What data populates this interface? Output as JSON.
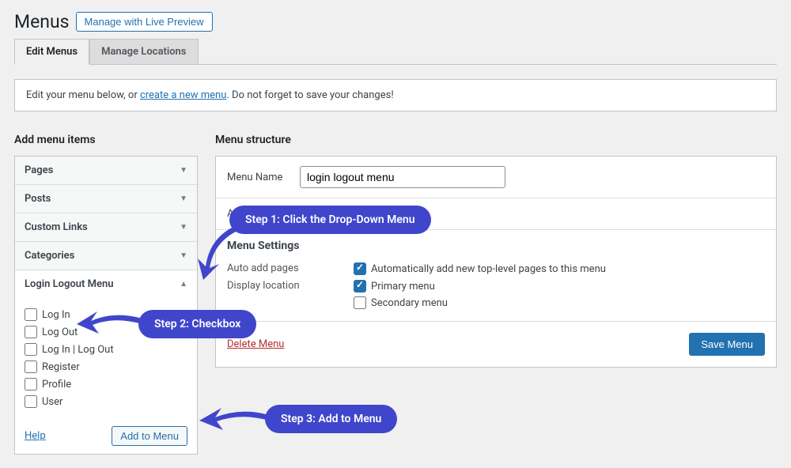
{
  "page_title": "Menus",
  "preview_button": "Manage with Live Preview",
  "tabs": {
    "edit": "Edit Menus",
    "locations": "Manage Locations"
  },
  "notice": {
    "prefix": "Edit your menu below, or ",
    "link": "create a new menu",
    "suffix": ". Do not forget to save your changes!"
  },
  "left": {
    "heading": "Add menu items",
    "sections": {
      "pages": "Pages",
      "posts": "Posts",
      "custom_links": "Custom Links",
      "categories": "Categories",
      "login_logout": "Login Logout Menu"
    },
    "items": [
      "Log In",
      "Log Out",
      "Log In | Log Out",
      "Register",
      "Profile",
      "User"
    ],
    "help": "Help",
    "add_button": "Add to Menu"
  },
  "right": {
    "heading": "Menu structure",
    "menu_name_label": "Menu Name",
    "menu_name_value": "login logout menu",
    "add_prefix": "Ad",
    "settings": {
      "heading": "Menu Settings",
      "auto_add": {
        "label": "Auto add pages",
        "option": "Automatically add new top-level pages to this menu"
      },
      "display": {
        "label": "Display location",
        "primary": "Primary menu",
        "secondary": "Secondary menu"
      }
    },
    "delete": "Delete Menu",
    "save": "Save Menu"
  },
  "callouts": {
    "step1": "Step 1: Click the Drop-Down Menu",
    "step2": "Step 2: Checkbox",
    "step3": "Step 3: Add to Menu"
  }
}
